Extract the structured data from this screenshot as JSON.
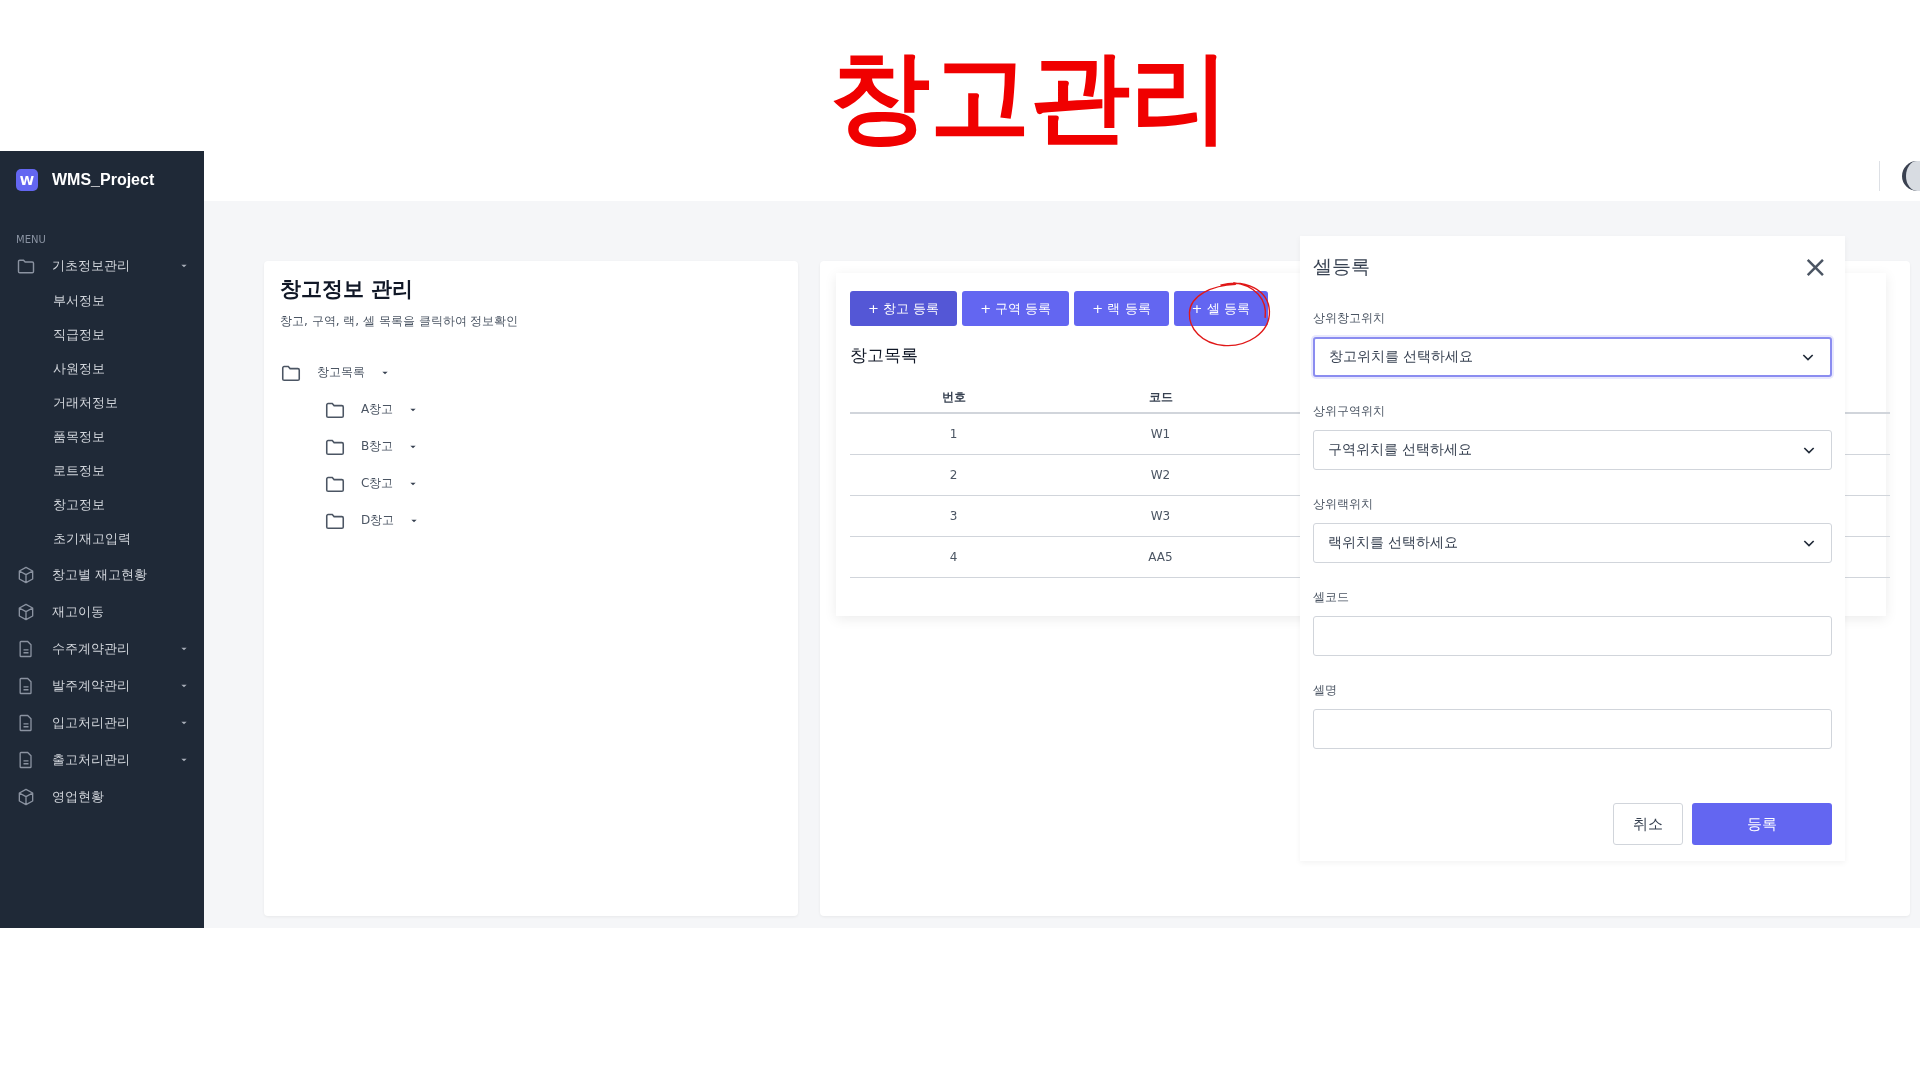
{
  "slide_title": "창고관리",
  "app": {
    "name": "WMS_Project",
    "logo_letter": "W"
  },
  "sidebar": {
    "menu_label": "MENU",
    "items": [
      {
        "label": "기초정보관리",
        "kind": "folder",
        "dropdown": true,
        "children": [
          {
            "label": "부서정보"
          },
          {
            "label": "직급정보"
          },
          {
            "label": "사원정보"
          },
          {
            "label": "거래처정보"
          },
          {
            "label": "품목정보"
          },
          {
            "label": "로트정보"
          },
          {
            "label": "창고정보"
          },
          {
            "label": "초기재고입력"
          }
        ]
      },
      {
        "label": "창고별 재고현황",
        "kind": "box",
        "dropdown": false
      },
      {
        "label": "재고이동",
        "kind": "box",
        "dropdown": false
      },
      {
        "label": "수주계약관리",
        "kind": "document",
        "dropdown": true
      },
      {
        "label": "발주계약관리",
        "kind": "document",
        "dropdown": true
      },
      {
        "label": "입고처리관리",
        "kind": "document",
        "dropdown": true
      },
      {
        "label": "출고처리관리",
        "kind": "document",
        "dropdown": true
      },
      {
        "label": "영업현황",
        "kind": "box",
        "dropdown": false
      }
    ]
  },
  "tree_panel": {
    "title": "창고정보 관리",
    "subtitle": "창고, 구역, 랙, 셀 목록을 클릭하여 정보확인",
    "tree": [
      {
        "label": "창고목록",
        "children": [
          {
            "label": "A창고"
          },
          {
            "label": "B창고"
          },
          {
            "label": "C창고"
          },
          {
            "label": "D창고"
          }
        ]
      }
    ]
  },
  "list_panel": {
    "buttons": [
      {
        "label": "+ 창고 등록",
        "selected": true
      },
      {
        "label": "+ 구역 등록",
        "selected": false
      },
      {
        "label": "+ 랙 등록",
        "selected": false
      },
      {
        "label": "+ 셀 등록",
        "selected": false
      }
    ],
    "title": "창고목록",
    "table": {
      "columns": [
        "번호",
        "코드"
      ],
      "rows": [
        [
          "1",
          "W1"
        ],
        [
          "2",
          "W2"
        ],
        [
          "3",
          "W3"
        ],
        [
          "4",
          "AA5"
        ]
      ]
    }
  },
  "dialog": {
    "title": "셀등록",
    "close": "×",
    "fields": [
      {
        "label": "상위창고위치",
        "kind": "select",
        "placeholder": "창고위치를 선택하세요",
        "focused": true
      },
      {
        "label": "상위구역위치",
        "kind": "select",
        "placeholder": "구역위치를 선택하세요",
        "focused": false
      },
      {
        "label": "상위랙위치",
        "kind": "select",
        "placeholder": "랙위치를 선택하세요",
        "focused": false
      },
      {
        "label": "셀코드",
        "kind": "text",
        "focused": false
      },
      {
        "label": "셀명",
        "kind": "text",
        "focused": false
      }
    ],
    "buttons": [
      {
        "label": "취소",
        "kind": "secondary"
      },
      {
        "label": "등록",
        "kind": "primary"
      }
    ]
  }
}
